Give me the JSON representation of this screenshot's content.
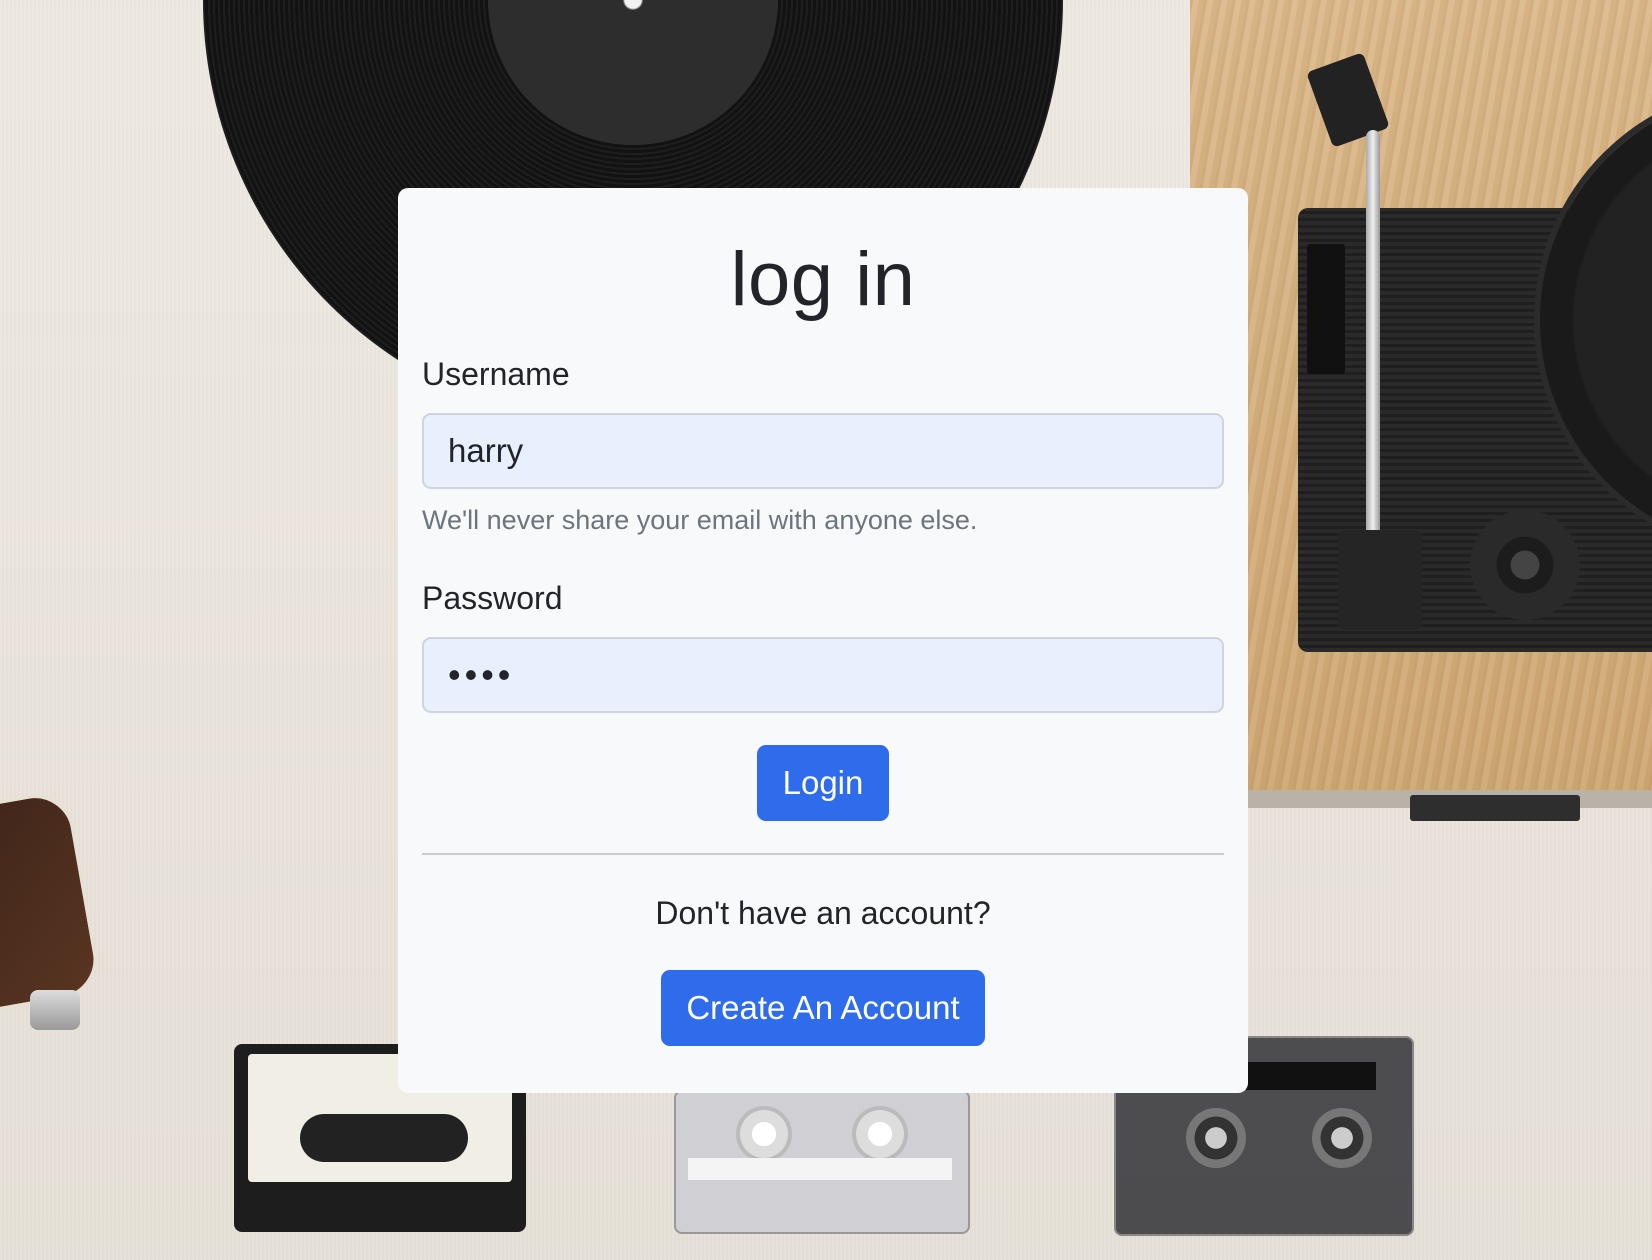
{
  "login_card": {
    "title": "log in",
    "username": {
      "label": "Username",
      "value": "harry",
      "help_text": "We'll never share your email with anyone else."
    },
    "password": {
      "label": "Password",
      "value": "••••"
    },
    "login_button_label": "Login",
    "signup_prompt": "Don't have an account?",
    "create_account_button_label": "Create An Account"
  },
  "colors": {
    "primary": "#2f6cec",
    "card_background": "#f8f9fa",
    "input_background": "#e8f0fe",
    "help_text": "#6c757d"
  }
}
